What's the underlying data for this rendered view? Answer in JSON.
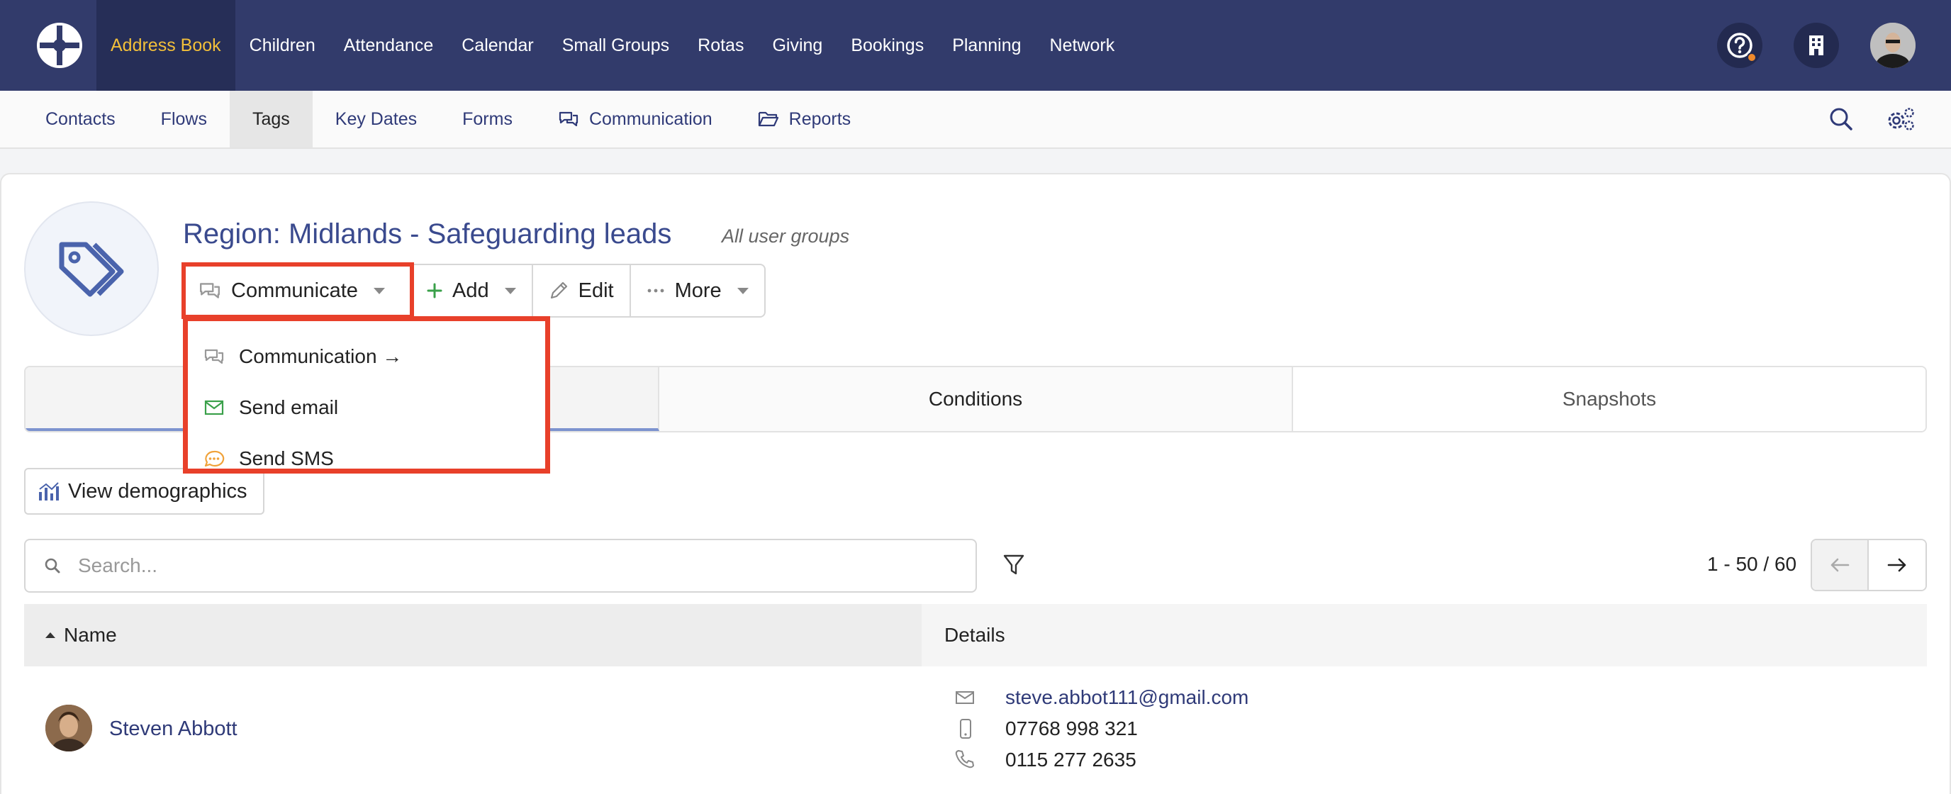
{
  "topnav": {
    "items": [
      {
        "label": "Address Book",
        "active": true
      },
      {
        "label": "Children"
      },
      {
        "label": "Attendance"
      },
      {
        "label": "Calendar"
      },
      {
        "label": "Small Groups"
      },
      {
        "label": "Rotas"
      },
      {
        "label": "Giving"
      },
      {
        "label": "Bookings"
      },
      {
        "label": "Planning"
      },
      {
        "label": "Network"
      }
    ],
    "right_icons": [
      "help-icon",
      "building-icon",
      "user-avatar"
    ],
    "colors": {
      "bg": "#323b6b",
      "active_text": "#f2bf3a"
    }
  },
  "subnav": {
    "items": [
      {
        "label": "Contacts"
      },
      {
        "label": "Flows"
      },
      {
        "label": "Tags",
        "active": true
      },
      {
        "label": "Key Dates"
      },
      {
        "label": "Forms"
      },
      {
        "label": "Communication",
        "icon": "chat-icon"
      },
      {
        "label": "Reports",
        "icon": "folder-icon"
      }
    ],
    "right_icons": [
      "search-icon",
      "settings-icon"
    ]
  },
  "tag": {
    "title": "Region: Midlands - Safeguarding leads",
    "subtitle": "All user groups"
  },
  "actions": {
    "communicate": "Communicate",
    "add": "Add",
    "edit": "Edit",
    "more": "More"
  },
  "dropdown": {
    "items": [
      {
        "label": "Communication →",
        "icon": "chat-icon"
      },
      {
        "label": "Send email",
        "icon": "email-icon"
      },
      {
        "label": "Send SMS",
        "icon": "sms-icon"
      }
    ]
  },
  "tabs": [
    {
      "label": "",
      "active": true
    },
    {
      "label": "Conditions"
    },
    {
      "label": "Snapshots"
    }
  ],
  "demographics_label": "View demographics",
  "search": {
    "placeholder": "Search..."
  },
  "pager": {
    "text": "1 - 50 / 60"
  },
  "table": {
    "headers": {
      "name": "Name",
      "details": "Details"
    },
    "rows": [
      {
        "name": "Steven Abbott",
        "email": "steve.abbot111@gmail.com",
        "mobile": "07768 998 321",
        "phone": "0115 277 2635"
      }
    ]
  },
  "highlight_color": "#e8402a"
}
